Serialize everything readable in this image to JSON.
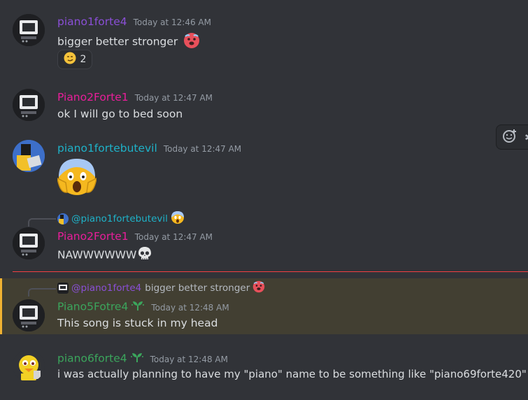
{
  "messages": [
    {
      "username": "piano1forte4",
      "username_color": "#8a4fd6",
      "time": "Today at 12:46 AM",
      "text": "bigger better stronger",
      "reaction": {
        "emoji": "smirk",
        "count": "2"
      }
    },
    {
      "username": "Piano2Forte1",
      "username_color": "#e91e9a",
      "time": "Today at 12:47 AM",
      "text": "ok I will go to bed soon"
    },
    {
      "username": "piano1fortebutevil",
      "username_color": "#1eb2c8",
      "time": "Today at 12:47 AM",
      "text": ""
    },
    {
      "reply": {
        "mention": "@piano1fortebutevil"
      },
      "username": "Piano2Forte1",
      "username_color": "#e91e9a",
      "time": "Today at 12:47 AM",
      "text": "NAWWWWWW"
    },
    {
      "reply": {
        "name": "@piano1forte4",
        "text": "bigger better stronger"
      },
      "username": "Piano5Fotre4",
      "username_color": "#3ba55c",
      "time": "Today at 12:48 AM",
      "text": "This song is stuck in my head"
    },
    {
      "username": "piano6forte4",
      "username_color": "#3ba55c",
      "time": "Today at 12:48 AM",
      "text": "i was actually planning to have my \"piano\" name to be something like \"piano69forte420\""
    }
  ],
  "colors": {
    "background": "#313338",
    "new_messages_divider": "#f23f42",
    "mention_highlight": "#f0b232",
    "timestamp": "#949ba4"
  },
  "icons": {
    "reaction_emoji": "smirk-emoji",
    "hover_tool": "add-reaction-icon",
    "inline_emoji_1": "hot-face-emoji",
    "inline_emoji_2": "scream-emoji",
    "inline_emoji_3": "skull-emoji",
    "role_badge": "sprout-icon"
  }
}
